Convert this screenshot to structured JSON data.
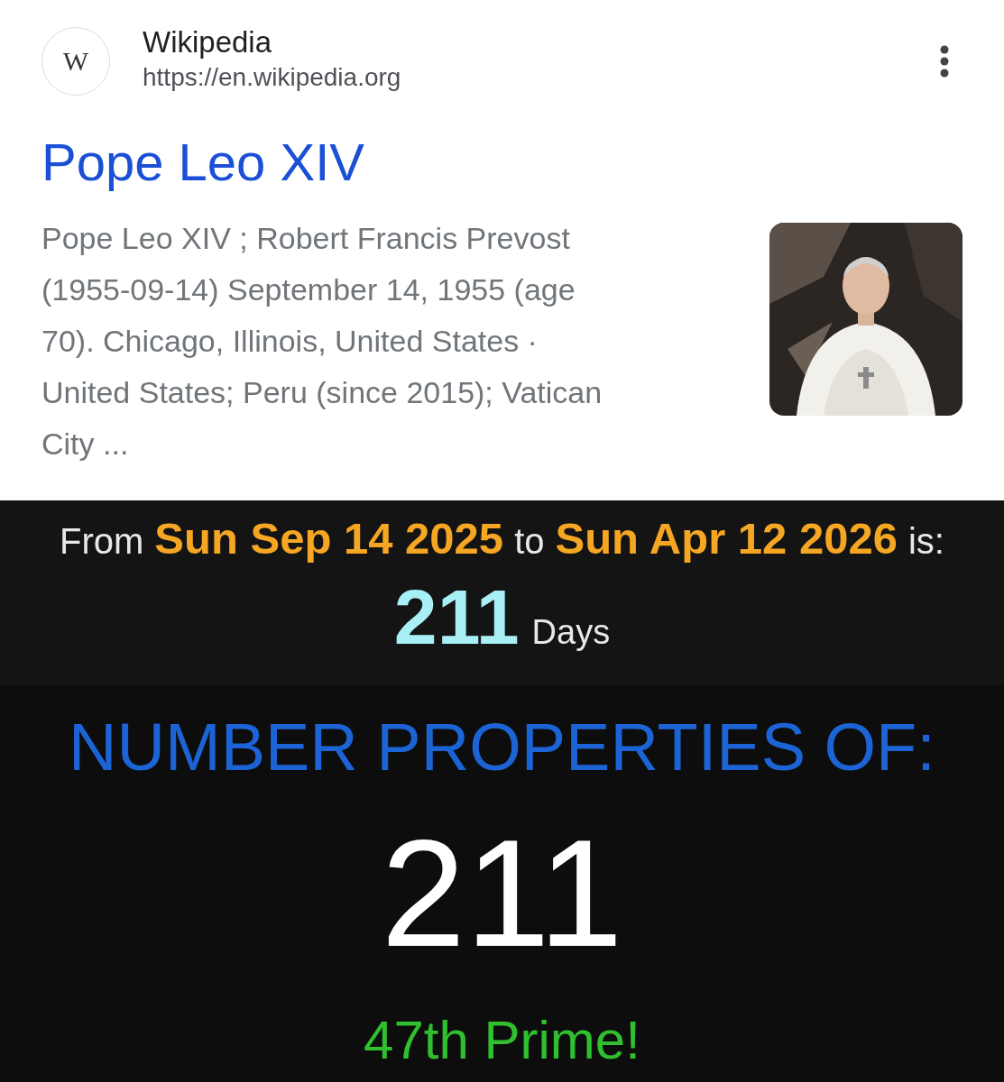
{
  "result": {
    "logo_letter": "W",
    "site_name": "Wikipedia",
    "url": "https://en.wikipedia.org",
    "title": "Pope Leo XIV",
    "snippet_lines": [
      "Pope Leo XIV ; Robert Francis Prevost",
      "(1955-09-14) September 14, 1955 (age",
      "70). Chicago, Illinois, United States ·",
      "United States; Peru (since 2015); Vatican",
      "City ..."
    ]
  },
  "calculator": {
    "from_label": "From",
    "start_date": "Sun Sep 14 2025",
    "to_label": "to",
    "end_date": "Sun Apr 12 2026",
    "is_label": "is:",
    "count": "211",
    "unit": "Days"
  },
  "properties": {
    "heading": "NUMBER PROPERTIES OF:",
    "number": "211",
    "fact": "47th Prime!"
  }
}
